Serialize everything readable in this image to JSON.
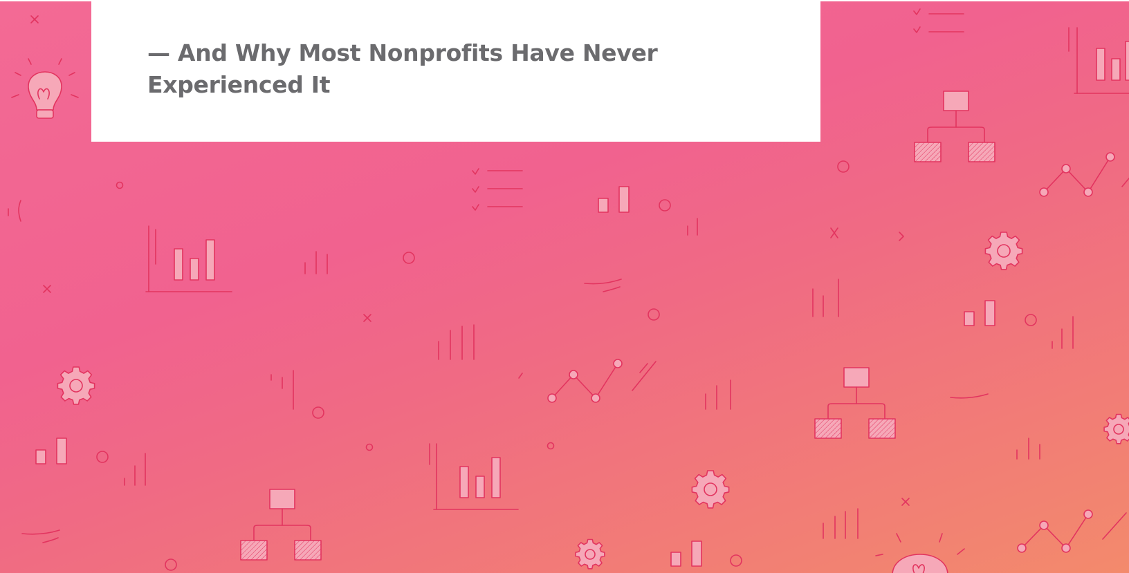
{
  "hero": {
    "subtitle": "— And Why Most Nonprofits Have Never Experienced It"
  },
  "icons": [
    "lightbulb-icon",
    "bar-chart-icon",
    "checklist-icon",
    "org-chart-icon",
    "gear-icon",
    "line-chart-icon"
  ],
  "colors": {
    "gradient_start": "#f36a95",
    "gradient_end": "#f38a6c",
    "doodle_stroke": "#e2345f",
    "doodle_fill": "#f6a8b8",
    "card_background": "#ffffff",
    "subtitle_text": "#6b6b6e"
  }
}
